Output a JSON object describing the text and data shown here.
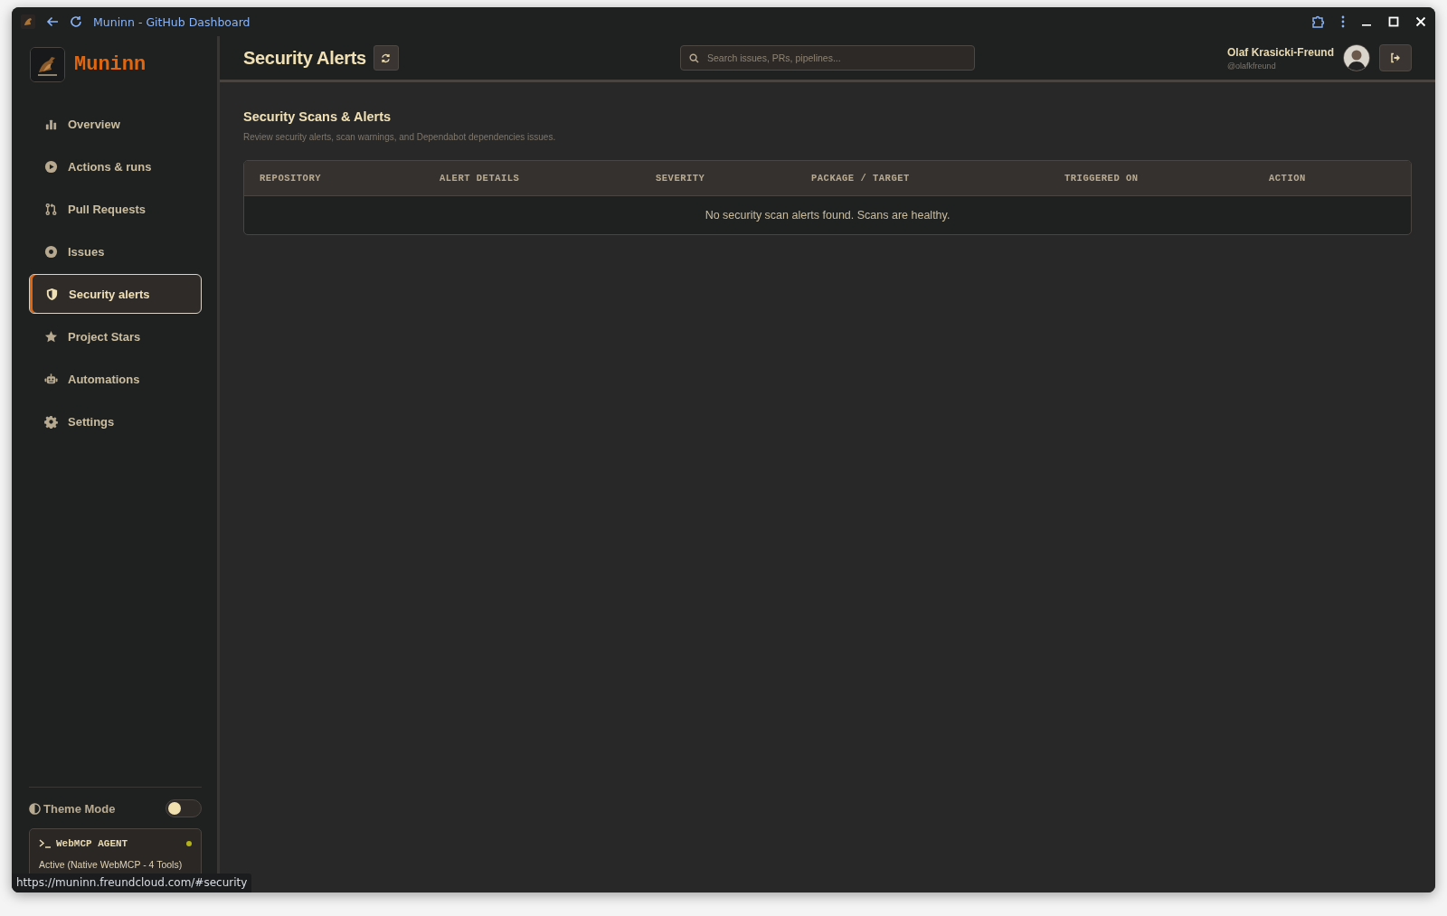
{
  "window": {
    "title": "Muninn - GitHub Dashboard"
  },
  "sidebar": {
    "brand": "Muninn",
    "items": [
      {
        "label": "Overview",
        "selected": false
      },
      {
        "label": "Actions & runs",
        "selected": false
      },
      {
        "label": "Pull Requests",
        "selected": false
      },
      {
        "label": "Issues",
        "selected": false
      },
      {
        "label": "Security alerts",
        "selected": true
      },
      {
        "label": "Project Stars",
        "selected": false
      },
      {
        "label": "Automations",
        "selected": false
      },
      {
        "label": "Settings",
        "selected": false
      }
    ],
    "theme_mode": {
      "label": "Theme Mode",
      "on": false
    },
    "agent": {
      "title": "WebMCP AGENT",
      "status": "Active (Native WebMCP - 4 Tools)",
      "active": true
    }
  },
  "header": {
    "title": "Security Alerts",
    "search": {
      "placeholder": "Search issues, PRs, pipelines..."
    },
    "user": {
      "name": "Olaf Krasicki-Freund",
      "handle": "@olafkfreund"
    }
  },
  "section": {
    "title": "Security Scans & Alerts",
    "description": "Review security alerts, scan warnings, and Dependabot dependencies issues.",
    "table": {
      "columns": [
        "REPOSITORY",
        "ALERT DETAILS",
        "SEVERITY",
        "PACKAGE / TARGET",
        "TRIGGERED ON",
        "ACTION"
      ],
      "empty_message": "No security scan alerts found. Scans are healthy."
    }
  },
  "status_url": "https://muninn.freundcloud.com/#security"
}
